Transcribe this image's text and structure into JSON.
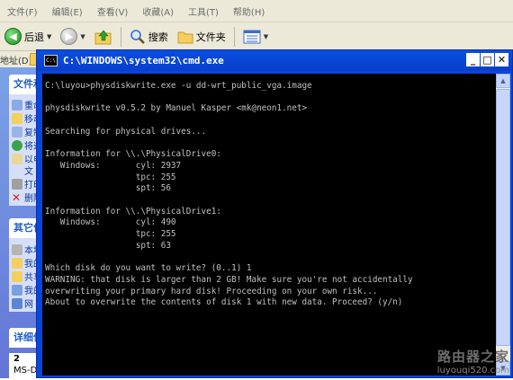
{
  "menu": {
    "items": [
      "文件(F)",
      "编辑(E)",
      "查看(V)",
      "收藏(A)",
      "工具(T)",
      "帮助(H)"
    ]
  },
  "toolbar": {
    "back_label": "后退",
    "search_label": "搜索",
    "folders_label": "文件夹"
  },
  "address": {
    "label": "地址(D)"
  },
  "sidepane": {
    "file_tasks_title": "文件和",
    "file_tasks": [
      "重命",
      "移动",
      "复制",
      "将这",
      "以电子",
      "文",
      "打印",
      "删除"
    ],
    "other_places_title": "其它位",
    "other_places": [
      "本地",
      "我的",
      "共享",
      "我的",
      "网"
    ],
    "details_title": "详细信",
    "details_lines": [
      "2",
      "MS-DOS 批处理文件"
    ]
  },
  "cmd": {
    "title": "C:\\WINDOWS\\system32\\cmd.exe",
    "icon_text": "C:\\",
    "lines": [
      "C:\\luyou>physdiskwrite.exe -u dd-wrt_public_vga.image",
      "",
      "physdiskwrite v0.5.2 by Manuel Kasper <mk@neon1.net>",
      "",
      "Searching for physical drives...",
      "",
      "Information for \\\\.\\PhysicalDrive0:",
      "   Windows:       cyl: 2937",
      "                  tpc: 255",
      "                  spt: 56",
      "",
      "Information for \\\\.\\PhysicalDrive1:",
      "   Windows:       cyl: 490",
      "                  tpc: 255",
      "                  spt: 63",
      "",
      "Which disk do you want to write? (0..1) 1",
      "WARNING: that disk is larger than 2 GB! Make sure you're not accidentally",
      "overwriting your primary hard disk! Proceeding on your own risk...",
      "About to overwrite the contents of disk 1 with new data. Proceed? (y/n)"
    ]
  },
  "watermark": {
    "title": "路由器之家",
    "url": "luyouqi520.com"
  },
  "colors": {
    "title_bar": "#0a46d8",
    "console_bg": "#000000",
    "console_text": "#c0c0c0",
    "sidepane": "#6f8ddd"
  }
}
